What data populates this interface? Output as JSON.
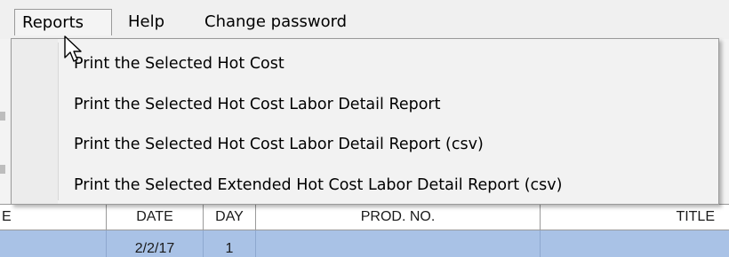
{
  "menubar": {
    "items": [
      {
        "label": "Reports"
      },
      {
        "label": "Help"
      },
      {
        "label": "Change password"
      }
    ]
  },
  "reports_menu": {
    "items": [
      {
        "label": "Print the Selected Hot Cost"
      },
      {
        "label": "Print the Selected Hot Cost Labor Detail Report"
      },
      {
        "label": "Print the Selected Hot Cost Labor Detail Report (csv)"
      },
      {
        "label": "Print the Selected Extended Hot Cost Labor Detail Report (csv)"
      }
    ]
  },
  "table": {
    "headers": [
      "E",
      "DATE",
      "DAY",
      "PROD. NO.",
      "TITLE"
    ],
    "selected_row": {
      "date": "2/2/17",
      "day": "1"
    }
  },
  "colors": {
    "selection": "#a9c2e6",
    "menu_background": "#f2f2f2"
  }
}
